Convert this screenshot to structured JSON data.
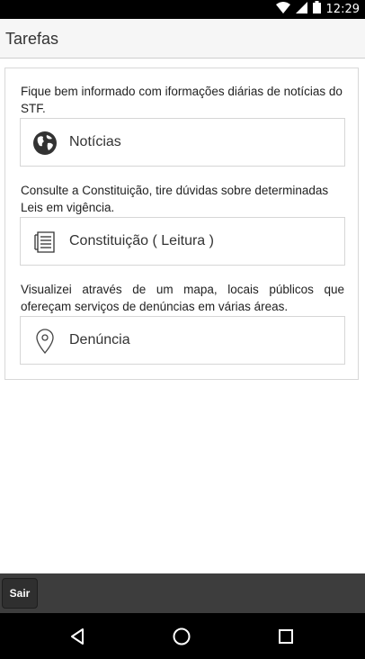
{
  "status_bar": {
    "time": "12:29",
    "icons": [
      "wifi-icon",
      "signal-icon",
      "battery-icon"
    ]
  },
  "header": {
    "title": "Tarefas"
  },
  "sections": [
    {
      "description": "Fique bem informado com iformações diárias de notícias do STF.",
      "button_label": "Notícias",
      "icon": "globe-icon"
    },
    {
      "description": "Consulte a Constituição, tire dúvidas sobre determinadas Leis em vigência.",
      "button_label": "Constituição ( Leitura )",
      "icon": "document-list-icon"
    },
    {
      "description": "Visualizei através de um mapa, locais públicos que ofereçam serviços de denúncias em várias áreas.",
      "button_label": "Denúncia",
      "icon": "map-pin-icon"
    }
  ],
  "footer": {
    "exit_label": "Sair"
  },
  "nav": {
    "icons": [
      "back-icon",
      "home-icon",
      "recents-icon"
    ]
  },
  "colors": {
    "header_bg": "#f6f6f6",
    "bottom_bar_bg": "#3d3d3d",
    "system_bar_bg": "#000000"
  }
}
